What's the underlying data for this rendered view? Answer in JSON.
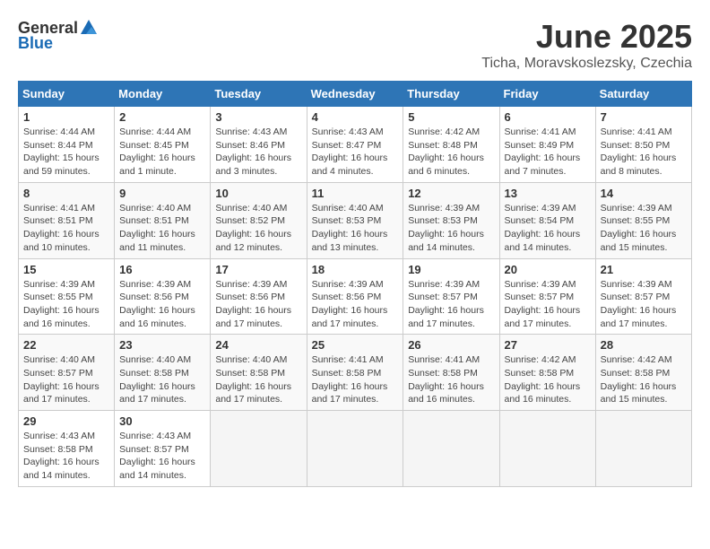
{
  "header": {
    "logo_general": "General",
    "logo_blue": "Blue",
    "month": "June 2025",
    "location": "Ticha, Moravskoslezsky, Czechia"
  },
  "weekdays": [
    "Sunday",
    "Monday",
    "Tuesday",
    "Wednesday",
    "Thursday",
    "Friday",
    "Saturday"
  ],
  "weeks": [
    [
      {
        "day": "1",
        "info": "Sunrise: 4:44 AM\nSunset: 8:44 PM\nDaylight: 15 hours\nand 59 minutes."
      },
      {
        "day": "2",
        "info": "Sunrise: 4:44 AM\nSunset: 8:45 PM\nDaylight: 16 hours\nand 1 minute."
      },
      {
        "day": "3",
        "info": "Sunrise: 4:43 AM\nSunset: 8:46 PM\nDaylight: 16 hours\nand 3 minutes."
      },
      {
        "day": "4",
        "info": "Sunrise: 4:43 AM\nSunset: 8:47 PM\nDaylight: 16 hours\nand 4 minutes."
      },
      {
        "day": "5",
        "info": "Sunrise: 4:42 AM\nSunset: 8:48 PM\nDaylight: 16 hours\nand 6 minutes."
      },
      {
        "day": "6",
        "info": "Sunrise: 4:41 AM\nSunset: 8:49 PM\nDaylight: 16 hours\nand 7 minutes."
      },
      {
        "day": "7",
        "info": "Sunrise: 4:41 AM\nSunset: 8:50 PM\nDaylight: 16 hours\nand 8 minutes."
      }
    ],
    [
      {
        "day": "8",
        "info": "Sunrise: 4:41 AM\nSunset: 8:51 PM\nDaylight: 16 hours\nand 10 minutes."
      },
      {
        "day": "9",
        "info": "Sunrise: 4:40 AM\nSunset: 8:51 PM\nDaylight: 16 hours\nand 11 minutes."
      },
      {
        "day": "10",
        "info": "Sunrise: 4:40 AM\nSunset: 8:52 PM\nDaylight: 16 hours\nand 12 minutes."
      },
      {
        "day": "11",
        "info": "Sunrise: 4:40 AM\nSunset: 8:53 PM\nDaylight: 16 hours\nand 13 minutes."
      },
      {
        "day": "12",
        "info": "Sunrise: 4:39 AM\nSunset: 8:53 PM\nDaylight: 16 hours\nand 14 minutes."
      },
      {
        "day": "13",
        "info": "Sunrise: 4:39 AM\nSunset: 8:54 PM\nDaylight: 16 hours\nand 14 minutes."
      },
      {
        "day": "14",
        "info": "Sunrise: 4:39 AM\nSunset: 8:55 PM\nDaylight: 16 hours\nand 15 minutes."
      }
    ],
    [
      {
        "day": "15",
        "info": "Sunrise: 4:39 AM\nSunset: 8:55 PM\nDaylight: 16 hours\nand 16 minutes."
      },
      {
        "day": "16",
        "info": "Sunrise: 4:39 AM\nSunset: 8:56 PM\nDaylight: 16 hours\nand 16 minutes."
      },
      {
        "day": "17",
        "info": "Sunrise: 4:39 AM\nSunset: 8:56 PM\nDaylight: 16 hours\nand 17 minutes."
      },
      {
        "day": "18",
        "info": "Sunrise: 4:39 AM\nSunset: 8:56 PM\nDaylight: 16 hours\nand 17 minutes."
      },
      {
        "day": "19",
        "info": "Sunrise: 4:39 AM\nSunset: 8:57 PM\nDaylight: 16 hours\nand 17 minutes."
      },
      {
        "day": "20",
        "info": "Sunrise: 4:39 AM\nSunset: 8:57 PM\nDaylight: 16 hours\nand 17 minutes."
      },
      {
        "day": "21",
        "info": "Sunrise: 4:39 AM\nSunset: 8:57 PM\nDaylight: 16 hours\nand 17 minutes."
      }
    ],
    [
      {
        "day": "22",
        "info": "Sunrise: 4:40 AM\nSunset: 8:57 PM\nDaylight: 16 hours\nand 17 minutes."
      },
      {
        "day": "23",
        "info": "Sunrise: 4:40 AM\nSunset: 8:58 PM\nDaylight: 16 hours\nand 17 minutes."
      },
      {
        "day": "24",
        "info": "Sunrise: 4:40 AM\nSunset: 8:58 PM\nDaylight: 16 hours\nand 17 minutes."
      },
      {
        "day": "25",
        "info": "Sunrise: 4:41 AM\nSunset: 8:58 PM\nDaylight: 16 hours\nand 17 minutes."
      },
      {
        "day": "26",
        "info": "Sunrise: 4:41 AM\nSunset: 8:58 PM\nDaylight: 16 hours\nand 16 minutes."
      },
      {
        "day": "27",
        "info": "Sunrise: 4:42 AM\nSunset: 8:58 PM\nDaylight: 16 hours\nand 16 minutes."
      },
      {
        "day": "28",
        "info": "Sunrise: 4:42 AM\nSunset: 8:58 PM\nDaylight: 16 hours\nand 15 minutes."
      }
    ],
    [
      {
        "day": "29",
        "info": "Sunrise: 4:43 AM\nSunset: 8:58 PM\nDaylight: 16 hours\nand 14 minutes."
      },
      {
        "day": "30",
        "info": "Sunrise: 4:43 AM\nSunset: 8:57 PM\nDaylight: 16 hours\nand 14 minutes."
      },
      null,
      null,
      null,
      null,
      null
    ]
  ]
}
